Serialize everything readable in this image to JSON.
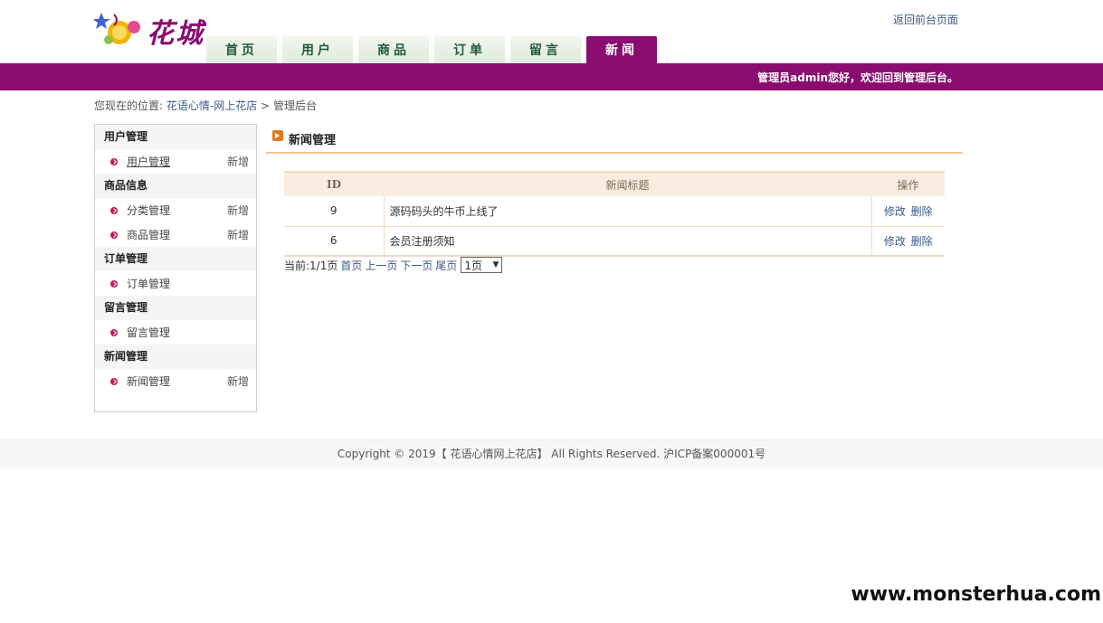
{
  "header": {
    "logo_text": "花城",
    "top_link": "返回前台页面",
    "welcome": "管理员admin您好，欢迎回到管理后台。"
  },
  "nav": {
    "tabs": [
      {
        "label": "首页",
        "active": false
      },
      {
        "label": "用户",
        "active": false
      },
      {
        "label": "商品",
        "active": false
      },
      {
        "label": "订单",
        "active": false
      },
      {
        "label": "留言",
        "active": false
      },
      {
        "label": "新闻",
        "active": true
      }
    ]
  },
  "breadcrumb": {
    "prefix": "您现在的位置:",
    "home": "花语心情-网上花店",
    "sep": ">",
    "current": "管理后台"
  },
  "sidebar": {
    "groups": [
      {
        "title": "用户管理",
        "items": [
          {
            "label": "用户管理",
            "add": "新增"
          }
        ]
      },
      {
        "title": "商品信息",
        "items": [
          {
            "label": "分类管理",
            "add": "新增"
          },
          {
            "label": "商品管理",
            "add": "新增"
          }
        ]
      },
      {
        "title": "订单管理",
        "items": [
          {
            "label": "订单管理",
            "add": ""
          }
        ]
      },
      {
        "title": "留言管理",
        "items": [
          {
            "label": "留言管理",
            "add": ""
          }
        ]
      },
      {
        "title": "新闻管理",
        "items": [
          {
            "label": "新闻管理",
            "add": "新增"
          }
        ]
      }
    ]
  },
  "main": {
    "title": "新闻管理",
    "table": {
      "headers": {
        "id": "ID",
        "title": "新闻标题",
        "ops": "操作"
      },
      "rows": [
        {
          "id": "9",
          "title": "源码码头的牛币上线了",
          "edit": "修改",
          "del": "删除"
        },
        {
          "id": "6",
          "title": "会员注册须知",
          "edit": "修改",
          "del": "删除"
        }
      ]
    },
    "pager": {
      "status": "当前:1/1页",
      "first": "首页",
      "prev": "上一页",
      "next": "下一页",
      "last": "尾页",
      "select_value": "1页"
    }
  },
  "footer": {
    "text": "Copyright © 2019【 花语心情网上花店】 All Rights Reserved. 沪ICP备案000001号"
  },
  "watermark": "www.monsterhua.com",
  "colors": {
    "brand_purple": "#8a0c6f",
    "nav_green": "#dfeadb",
    "table_header": "#f9ede2",
    "accent_orange": "#e07a20"
  }
}
